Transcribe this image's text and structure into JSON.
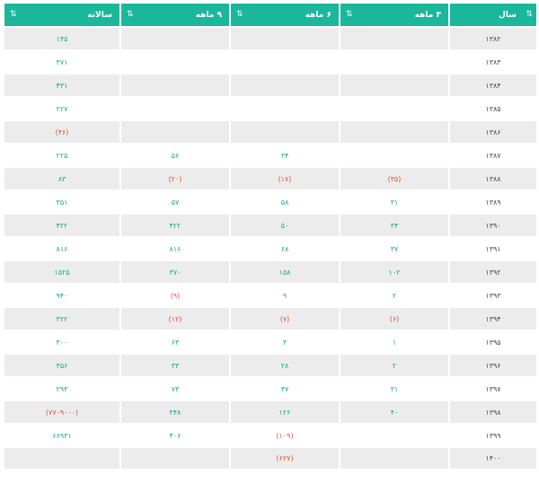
{
  "header": {
    "year": "سال",
    "three_month": "۳ ماهه",
    "six_month": "۶ ماهه",
    "nine_month": "۹ ماهه",
    "annual": "سالانه",
    "sort_icon": "⇅"
  },
  "colors": {
    "header_bg": "#1bb79b",
    "positive": "#19a98c",
    "negative": "#e2513c",
    "stripe": "#ececec"
  },
  "rows": [
    {
      "year": "۱۳۸۲",
      "q3": "",
      "q6": "",
      "q9": "",
      "annual": "۱۴۵"
    },
    {
      "year": "۱۳۸۳",
      "q3": "",
      "q6": "",
      "q9": "",
      "annual": "۳۷۱"
    },
    {
      "year": "۱۳۸۴",
      "q3": "",
      "q6": "",
      "q9": "",
      "annual": "۴۳۱"
    },
    {
      "year": "۱۳۸۵",
      "q3": "",
      "q6": "",
      "q9": "",
      "annual": "۲۲۷"
    },
    {
      "year": "۱۳۸۶",
      "q3": "",
      "q6": "",
      "q9": "",
      "annual": "(۴۶)"
    },
    {
      "year": "۱۳۸۷",
      "q3": "",
      "q6": "۳۴",
      "q9": "۵۶",
      "annual": "۲۲۵"
    },
    {
      "year": "۱۳۸۸",
      "q3": "(۳۵)",
      "q6": "(۱۷)",
      "q9": "(۲۰)",
      "annual": "۸۳"
    },
    {
      "year": "۱۳۸۹",
      "q3": "۳۱",
      "q6": "۵۸",
      "q9": "۵۷",
      "annual": "۳۵۱"
    },
    {
      "year": "۱۳۹۰",
      "q3": "۳۴",
      "q6": "۵۰",
      "q9": "۴۲۲",
      "annual": "۴۲۲"
    },
    {
      "year": "۱۳۹۱",
      "q3": "۳۷",
      "q6": "۶۸",
      "q9": "۸۱۶",
      "annual": "۸۱۶"
    },
    {
      "year": "۱۳۹۲",
      "q3": "۱۰۲",
      "q6": "۱۵۸",
      "q9": "۳۷۰",
      "annual": "۱۵۲۵"
    },
    {
      "year": "۱۳۹۳",
      "q3": "۲",
      "q6": "۹",
      "q9": "(۹)",
      "annual": "۹۴۰"
    },
    {
      "year": "۱۳۹۴",
      "q3": "(۶)",
      "q6": "(۷)",
      "q9": "(۱۲)",
      "annual": "۳۲۲"
    },
    {
      "year": "۱۳۹۵",
      "q3": "۱",
      "q6": "۳",
      "q9": "۶۳",
      "annual": "۳۰۰"
    },
    {
      "year": "۱۳۹۶",
      "q3": "۲",
      "q6": "۲۸",
      "q9": "۳۳",
      "annual": "۳۵۶"
    },
    {
      "year": "۱۳۹۷",
      "q3": "۳۱",
      "q6": "۴۷",
      "q9": "۷۳",
      "annual": "۲۹۳"
    },
    {
      "year": "۱۳۹۸",
      "q3": "۴۰",
      "q6": "۱۲۶",
      "q9": "۳۴۸",
      "annual": "(۷۷۰۹۰۰۰)"
    },
    {
      "year": "۱۳۹۹",
      "q3": "",
      "q6": "(۱۰۹)",
      "q9": "۴۰۶",
      "annual": "۶۶۹۳۱"
    },
    {
      "year": "۱۴۰۰",
      "q3": "",
      "q6": "(۶۲۷)",
      "q9": "",
      "annual": ""
    }
  ]
}
